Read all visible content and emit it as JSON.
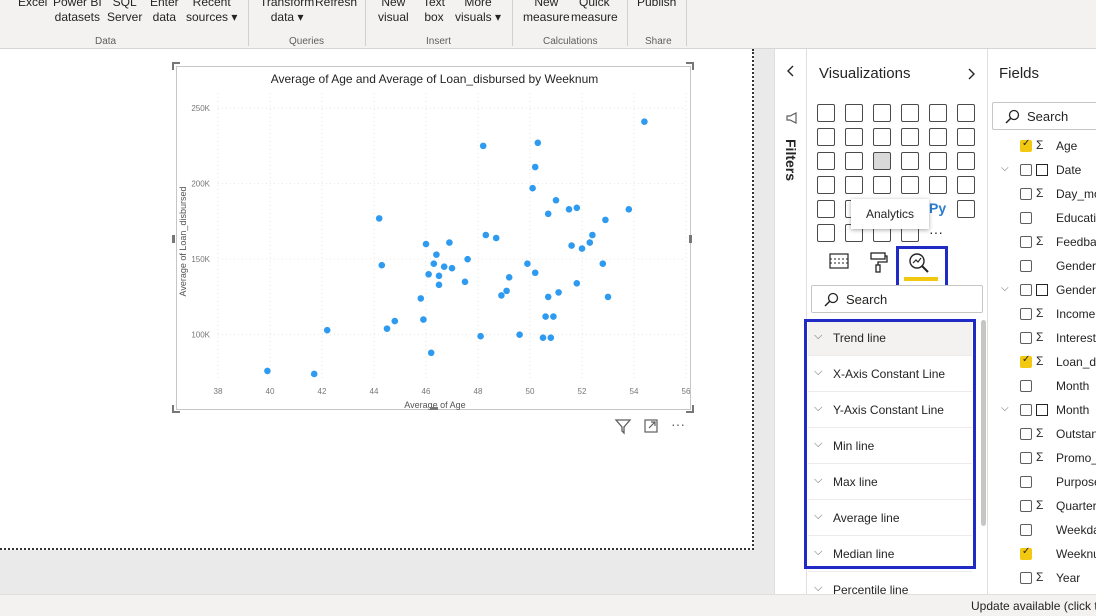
{
  "ribbon": {
    "buttons": [
      {
        "line1": "Excel",
        "line2": ""
      },
      {
        "line1": "Power BI",
        "line2": "datasets"
      },
      {
        "line1": "SQL",
        "line2": "Server"
      },
      {
        "line1": "Enter",
        "line2": "data"
      },
      {
        "line1": "Recent",
        "line2": "sources ▾"
      },
      {
        "line1": "Transform",
        "line2": "data ▾"
      },
      {
        "line1": "Refresh",
        "line2": ""
      },
      {
        "line1": "New",
        "line2": "visual"
      },
      {
        "line1": "Text",
        "line2": "box"
      },
      {
        "line1": "More",
        "line2": "visuals ▾"
      },
      {
        "line1": "New",
        "line2": "measure"
      },
      {
        "line1": "Quick",
        "line2": "measure"
      },
      {
        "line1": "Publish",
        "line2": ""
      }
    ],
    "groups": [
      "Data",
      "Queries",
      "Insert",
      "Calculations",
      "Share"
    ]
  },
  "visual": {
    "more_options": "···"
  },
  "chart_data": {
    "type": "scatter",
    "title": "Average of Age and Average of Loan_disbursed by Weeknum",
    "xlabel": "Average of Age",
    "ylabel": "Average of Loan_disbursed",
    "xlim": [
      38,
      56
    ],
    "ylim": [
      70000,
      260000
    ],
    "x_ticks": [
      "38",
      "40",
      "42",
      "44",
      "46",
      "48",
      "50",
      "52",
      "54",
      "56"
    ],
    "y_ticks": [
      {
        "value": 100000,
        "label": "100K"
      },
      {
        "value": 150000,
        "label": "150K"
      },
      {
        "value": 200000,
        "label": "200K"
      },
      {
        "value": 250000,
        "label": "250K"
      }
    ],
    "color": "#2e9bf0",
    "grid": true,
    "points": [
      [
        39.9,
        76000
      ],
      [
        41.7,
        74000
      ],
      [
        42.2,
        103000
      ],
      [
        44.2,
        177000
      ],
      [
        44.3,
        146000
      ],
      [
        44.5,
        104000
      ],
      [
        44.8,
        109000
      ],
      [
        45.8,
        124000
      ],
      [
        45.9,
        110000
      ],
      [
        46.0,
        160000
      ],
      [
        46.1,
        140000
      ],
      [
        46.2,
        88000
      ],
      [
        46.3,
        147000
      ],
      [
        46.4,
        153000
      ],
      [
        46.5,
        133000
      ],
      [
        46.5,
        139000
      ],
      [
        46.7,
        145000
      ],
      [
        46.9,
        161000
      ],
      [
        47.0,
        144000
      ],
      [
        47.5,
        135000
      ],
      [
        47.6,
        150000
      ],
      [
        48.1,
        99000
      ],
      [
        48.2,
        225000
      ],
      [
        48.3,
        166000
      ],
      [
        48.7,
        164000
      ],
      [
        48.9,
        126000
      ],
      [
        49.1,
        129000
      ],
      [
        49.2,
        138000
      ],
      [
        49.6,
        100000
      ],
      [
        49.9,
        147000
      ],
      [
        50.1,
        197000
      ],
      [
        50.2,
        211000
      ],
      [
        50.2,
        141000
      ],
      [
        50.3,
        227000
      ],
      [
        50.5,
        98000
      ],
      [
        50.6,
        112000
      ],
      [
        50.7,
        180000
      ],
      [
        50.7,
        125000
      ],
      [
        50.8,
        98000
      ],
      [
        50.9,
        112000
      ],
      [
        51.0,
        189000
      ],
      [
        51.1,
        128000
      ],
      [
        51.5,
        183000
      ],
      [
        51.6,
        159000
      ],
      [
        51.8,
        184000
      ],
      [
        51.8,
        134000
      ],
      [
        52.0,
        157000
      ],
      [
        52.3,
        161000
      ],
      [
        52.4,
        166000
      ],
      [
        52.8,
        147000
      ],
      [
        52.9,
        176000
      ],
      [
        53.0,
        125000
      ],
      [
        53.8,
        183000
      ],
      [
        54.4,
        241000
      ]
    ]
  },
  "filters": {
    "label": "Filters"
  },
  "visualizations": {
    "title": "Visualizations",
    "tooltip": "Analytics",
    "search_placeholder": "Search",
    "analytics_items": [
      "Trend line",
      "X-Axis Constant Line",
      "Y-Axis Constant Line",
      "Min line",
      "Max line",
      "Average line",
      "Median line",
      "Percentile line"
    ]
  },
  "fields": {
    "title": "Fields",
    "search_placeholder": "Search",
    "items": [
      {
        "name": "Age",
        "checked": true,
        "sigma": true,
        "expandable": false,
        "table": false
      },
      {
        "name": "Date",
        "checked": false,
        "sigma": false,
        "expandable": true,
        "table": true
      },
      {
        "name": "Day_mo",
        "checked": false,
        "sigma": true,
        "expandable": false,
        "table": false
      },
      {
        "name": "Educatio",
        "checked": false,
        "sigma": false,
        "expandable": false,
        "table": false
      },
      {
        "name": "Feedbac",
        "checked": false,
        "sigma": true,
        "expandable": false,
        "table": false
      },
      {
        "name": "Gender",
        "checked": false,
        "sigma": false,
        "expandable": false,
        "table": false
      },
      {
        "name": "Gender",
        "checked": false,
        "sigma": false,
        "expandable": true,
        "table": true
      },
      {
        "name": "Income",
        "checked": false,
        "sigma": true,
        "expandable": false,
        "table": false
      },
      {
        "name": "Interest",
        "checked": false,
        "sigma": true,
        "expandable": false,
        "table": false
      },
      {
        "name": "Loan_di",
        "checked": true,
        "sigma": true,
        "expandable": false,
        "table": false
      },
      {
        "name": "Month",
        "checked": false,
        "sigma": false,
        "expandable": false,
        "table": false
      },
      {
        "name": "Month",
        "checked": false,
        "sigma": false,
        "expandable": true,
        "table": true
      },
      {
        "name": "Outstan",
        "checked": false,
        "sigma": true,
        "expandable": false,
        "table": false
      },
      {
        "name": "Promo_",
        "checked": false,
        "sigma": true,
        "expandable": false,
        "table": false
      },
      {
        "name": "Purpose",
        "checked": false,
        "sigma": false,
        "expandable": false,
        "table": false
      },
      {
        "name": "Quarter",
        "checked": false,
        "sigma": true,
        "expandable": false,
        "table": false
      },
      {
        "name": "Weekda",
        "checked": false,
        "sigma": false,
        "expandable": false,
        "table": false
      },
      {
        "name": "Weeknu",
        "checked": true,
        "sigma": false,
        "expandable": false,
        "table": false
      },
      {
        "name": "Year",
        "checked": false,
        "sigma": true,
        "expandable": false,
        "table": false
      }
    ]
  },
  "status": {
    "text": "Update available (click to"
  }
}
